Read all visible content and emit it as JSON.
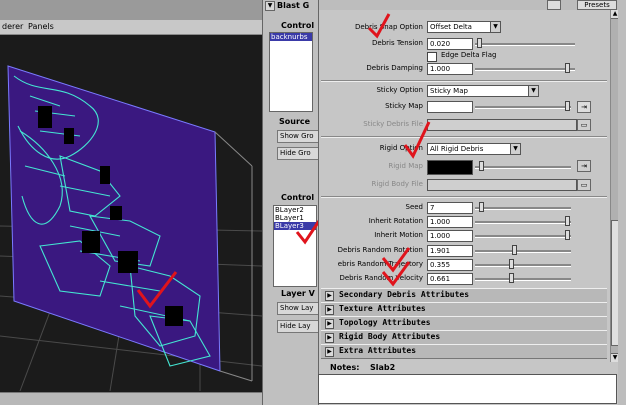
{
  "viewport": {
    "menu": [
      "derer",
      "Panels"
    ]
  },
  "outliner": {
    "header1": "Blast G",
    "control1": "Control",
    "list1": [
      "backnurbs"
    ],
    "source": "Source",
    "show_btn1": "Show Gro",
    "hide_btn1": "Hide Gro",
    "control2": "Control",
    "list2": [
      "BLayer2",
      "BLayer1",
      "BLayer3"
    ],
    "layer_header": "Layer V",
    "show_btn2": "Show Lay",
    "hide_btn2": "Hide Lay"
  },
  "attr": {
    "presets": "Presets",
    "rows": {
      "debris_snap_option": {
        "label": "Debris Snap Option",
        "value": "Offset Delta"
      },
      "debris_tension": {
        "label": "Debris Tension",
        "value": "0.020"
      },
      "edge_delta_flag": {
        "label": "Edge Delta Flag"
      },
      "debris_damping": {
        "label": "Debris Damping",
        "value": "1.000"
      },
      "sticky_option": {
        "label": "Sticky Option",
        "value": "Sticky Map"
      },
      "sticky_map": {
        "label": "Sticky Map"
      },
      "sticky_debris_file": {
        "label": "Sticky Debris File"
      },
      "rigid_option": {
        "label": "Rigid Option",
        "value": "All Rigid Debris"
      },
      "rigid_map": {
        "label": "Rigid Map"
      },
      "rigid_body_file": {
        "label": "Rigid Body File"
      },
      "seed": {
        "label": "Seed",
        "value": "7"
      },
      "inherit_rotation": {
        "label": "Inherit Rotation",
        "value": "1.000"
      },
      "inherit_motion": {
        "label": "Inherit Motion",
        "value": "1.000"
      },
      "debris_random_rotation": {
        "label": "Debris Random Rotation",
        "value": "1.901"
      },
      "debris_random_trajectory": {
        "label": "ebris Random Trajectory",
        "value": "0.355"
      },
      "debris_random_velocity": {
        "label": "Debris Random Velocity",
        "value": "0.661"
      }
    },
    "sections": [
      "Secondary Debris Attributes",
      "Texture Attributes",
      "Topology Attributes",
      "Rigid Body Attributes",
      "Extra Attributes"
    ],
    "notes_label": "Notes:",
    "notes_value": "Slab2"
  },
  "colors": {
    "accent_check": "#e0141c",
    "wire": "#44e6d2",
    "panel": "#c6c6c6",
    "selection": "#3a3aa8"
  }
}
